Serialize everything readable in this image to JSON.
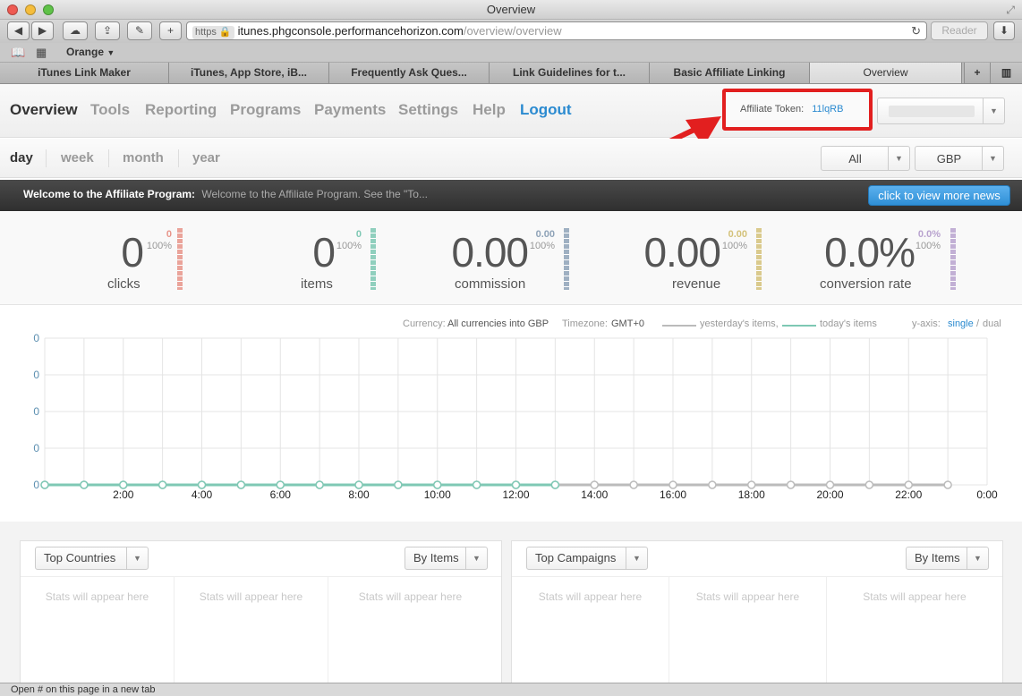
{
  "window": {
    "title": "Overview"
  },
  "browser": {
    "url_scheme": "https",
    "url_host": "itunes.phgconsole.performancehorizon.com",
    "url_path": "/overview/overview",
    "reader": "Reader",
    "bookmark_folder": "Orange",
    "tabs": [
      "iTunes Link Maker",
      "iTunes, App Store, iB...",
      "Frequently Ask Ques...",
      "Link Guidelines for t...",
      "Basic Affiliate Linking",
      "Overview"
    ],
    "new_tab": "+"
  },
  "nav": {
    "items": [
      "Overview",
      "Tools",
      "Reporting",
      "Programs",
      "Payments",
      "Settings",
      "Help",
      "Logout"
    ],
    "token_label": "Affiliate Token:",
    "token_value": "11lqRB"
  },
  "period": {
    "items": [
      "day",
      "week",
      "month",
      "year"
    ],
    "filter_value": "All",
    "currency_value": "GBP"
  },
  "news": {
    "title": "Welcome to the Affiliate Program:",
    "text": "Welcome to the Affiliate Program. See the \"To...",
    "button": "click to view more news"
  },
  "stats": [
    {
      "value": "0",
      "label": "clicks",
      "change": "0",
      "percent": "100%",
      "color": "#e8958a"
    },
    {
      "value": "0",
      "label": "items",
      "change": "0",
      "percent": "100%",
      "color": "#7ec8b4"
    },
    {
      "value": "0.00",
      "label": "commission",
      "change": "0.00",
      "percent": "100%",
      "color": "#8fa3b8"
    },
    {
      "value": "0.00",
      "label": "revenue",
      "change": "0.00",
      "percent": "100%",
      "color": "#d4c27a"
    },
    {
      "value": "0.0%",
      "label": "conversion rate",
      "change": "0.0%",
      "percent": "100%",
      "color": "#b9a3cf"
    }
  ],
  "chart_meta": {
    "currency_label": "Currency:",
    "currency_value": "All currencies into GBP",
    "timezone_label": "Timezone:",
    "timezone_value": "GMT+0",
    "legend_yesterday": "yesterday's items,",
    "legend_today": "today's items",
    "yaxis_label": "y-axis:",
    "yaxis_single": "single",
    "yaxis_sep": "/",
    "yaxis_dual": "dual"
  },
  "chart_data": {
    "type": "line",
    "x_labels": [
      "2:00",
      "4:00",
      "6:00",
      "8:00",
      "10:00",
      "12:00",
      "14:00",
      "16:00",
      "18:00",
      "20:00",
      "22:00",
      "0:00"
    ],
    "y_ticks": [
      "0",
      "0",
      "0",
      "0",
      "0"
    ],
    "series": [
      {
        "name": "yesterday's items",
        "color": "#bbbbbb",
        "values": [
          0,
          0,
          0,
          0,
          0,
          0,
          0,
          0,
          0,
          0,
          0,
          0,
          0,
          0,
          0,
          0,
          0,
          0,
          0,
          0,
          0,
          0,
          0,
          0
        ]
      },
      {
        "name": "today's items",
        "color": "#7ec8b4",
        "values": [
          0,
          0,
          0,
          0,
          0,
          0,
          0,
          0,
          0,
          0,
          0,
          0,
          0,
          0
        ]
      }
    ],
    "grid": true
  },
  "panels": [
    {
      "title": "Top Countries",
      "sort": "By Items",
      "placeholder": "Stats will appear here"
    },
    {
      "title": "Top Campaigns",
      "sort": "By Items",
      "placeholder": "Stats will appear here"
    }
  ],
  "status": "Open # on this page in a new tab"
}
